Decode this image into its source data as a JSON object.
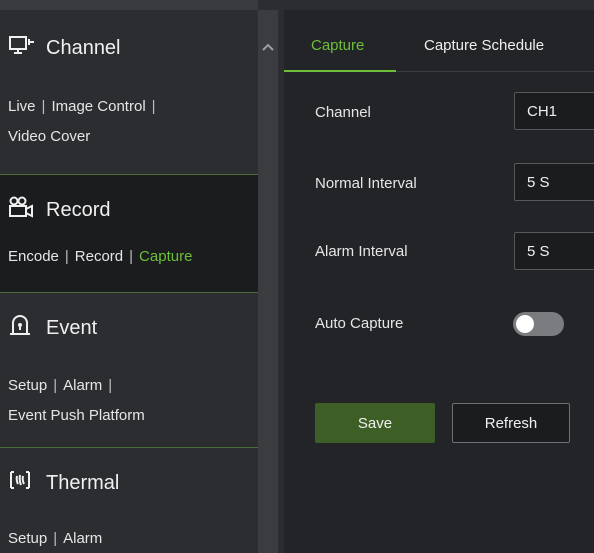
{
  "sidebar": {
    "channel": {
      "title": "Channel",
      "icon": "monitor-icon",
      "links": [
        "Live",
        "Image Control",
        "Video Cover"
      ]
    },
    "record": {
      "title": "Record",
      "icon": "camera-icon",
      "links": [
        "Encode",
        "Record",
        "Capture"
      ],
      "active_link": "Capture"
    },
    "event": {
      "title": "Event",
      "icon": "alarm-light-icon",
      "links": [
        "Setup",
        "Alarm",
        "Event Push Platform"
      ]
    },
    "thermal": {
      "title": "Thermal",
      "icon": "thermal-icon",
      "links": [
        "Setup",
        "Alarm"
      ]
    }
  },
  "tabs": [
    {
      "label": "Capture",
      "active": true
    },
    {
      "label": "Capture Schedule",
      "active": false
    }
  ],
  "form": {
    "channel": {
      "label": "Channel",
      "value": "CH1"
    },
    "normal_interval": {
      "label": "Normal Interval",
      "value": "5 S"
    },
    "alarm_interval": {
      "label": "Alarm Interval",
      "value": "5 S"
    },
    "auto_capture": {
      "label": "Auto Capture",
      "enabled": false
    }
  },
  "buttons": {
    "save": "Save",
    "refresh": "Refresh"
  },
  "colors": {
    "accent": "#6dbf3a",
    "save_bg": "#3d5f26",
    "active_section_bg": "#1b1c1e"
  }
}
